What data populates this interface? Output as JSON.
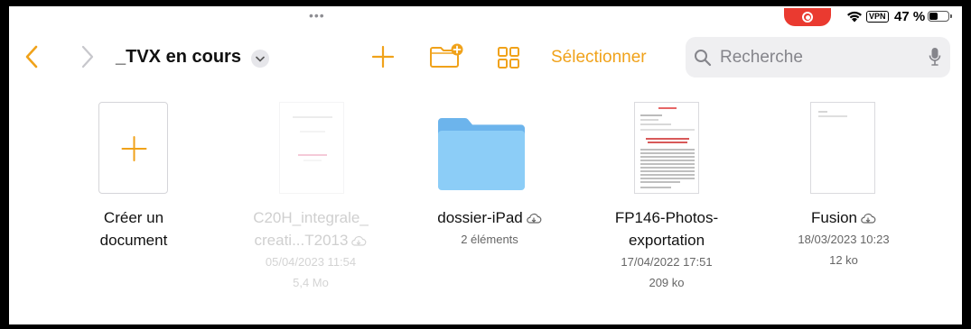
{
  "status_bar": {
    "vpn_label": "VPN",
    "battery_text": "47 %",
    "battery_level": 0.47
  },
  "toolbar": {
    "title": "_TVX en cours",
    "select_label": "Sélectionner",
    "accent_color": "#f0a21a"
  },
  "search": {
    "placeholder": "Recherche"
  },
  "items": [
    {
      "name_line1": "Créer un",
      "name_line2": "document"
    },
    {
      "name_line1": "C20H_integrale_",
      "name_line2": "creati...T2013",
      "date": "05/04/2023 11:54",
      "size": "5,4 Mo"
    },
    {
      "name": "dossier-iPad",
      "meta": "2 éléments"
    },
    {
      "name_line1": "FP146-Photos-",
      "name_line2": "exportation",
      "date": "17/04/2022 17:51",
      "size": "209 ko"
    },
    {
      "name": "Fusion",
      "date": "18/03/2023 10:23",
      "size": "12 ko"
    }
  ],
  "icons": [
    "chevron-left-icon",
    "chevron-right-icon",
    "chevron-down-icon",
    "plus-icon",
    "new-folder-icon",
    "grid-view-icon",
    "search-icon",
    "microphone-icon",
    "cloud-download-icon",
    "folder-icon",
    "wifi-icon",
    "screen-recording-icon"
  ]
}
